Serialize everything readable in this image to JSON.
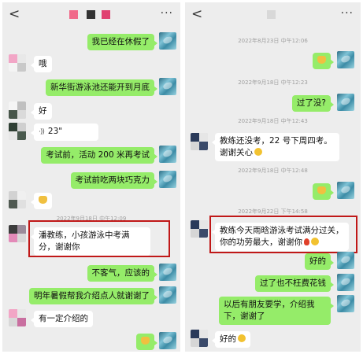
{
  "left": {
    "nav": {
      "back": "<",
      "more": "···"
    },
    "timestamp_partial": "2022年9月18日 中午12:09",
    "messages": [
      {
        "side": "me",
        "text": "我已经在休假了"
      },
      {
        "side": "other",
        "text": "哦"
      },
      {
        "side": "me",
        "text": "新华街游泳池还能开到月底"
      },
      {
        "side": "other",
        "text": "好"
      },
      {
        "side": "other",
        "type": "voice",
        "text": "23\""
      },
      {
        "side": "me",
        "text": "考试前，活动 200 米再考试"
      },
      {
        "side": "me",
        "text": "考试前吃两块巧克力"
      },
      {
        "side": "other",
        "type": "emoji",
        "emoji": "thumbs-up"
      },
      {
        "side": "other",
        "text": "潘教练，小孩游泳中考满分，谢谢你",
        "highlighted": true
      },
      {
        "side": "me",
        "text": "不客气，应该的"
      },
      {
        "side": "me",
        "text": "明年暑假帮我介绍点人就谢谢了"
      },
      {
        "side": "other",
        "text": "有一定介绍的"
      },
      {
        "side": "me",
        "type": "emoji",
        "emoji": "thumbs-up"
      }
    ]
  },
  "right": {
    "nav": {
      "back": "<",
      "more": "···"
    },
    "timestamps": {
      "t1": "2022年8月23日 中午12:06",
      "t2": "2022年9月18日 中午12:23",
      "t3": "2022年9月18日 中午12:43",
      "t4": "2022年9月18日 中午12:48",
      "t5": "2022年9月22日 下午14:58"
    },
    "messages": [
      {
        "side": "me",
        "type": "emoji",
        "emoji": "thumbs-up"
      },
      {
        "side": "me",
        "text": "过了没?"
      },
      {
        "side": "other",
        "text": "教练还没考，22 号下周四考。谢谢关心",
        "emoji": "smile"
      },
      {
        "side": "me",
        "type": "emoji",
        "emoji": "thumbs-up"
      },
      {
        "side": "other",
        "text": "教练今天雨晗游泳考试满分过关，你的功劳最大，谢谢你",
        "emoji": "rose+smile",
        "highlighted": true
      },
      {
        "side": "me",
        "text": "好的"
      },
      {
        "side": "me",
        "text": "过了也不枉费花钱"
      },
      {
        "side": "me",
        "text": "以后有朋友要学，介绍我下，谢谢了"
      },
      {
        "side": "other",
        "text": "好的",
        "emoji": "smile"
      }
    ]
  },
  "colors": {
    "sent_bubble": "#95ec69",
    "received_bubble": "#ffffff",
    "chat_bg": "#ededed",
    "highlight_box": "#c01818"
  }
}
